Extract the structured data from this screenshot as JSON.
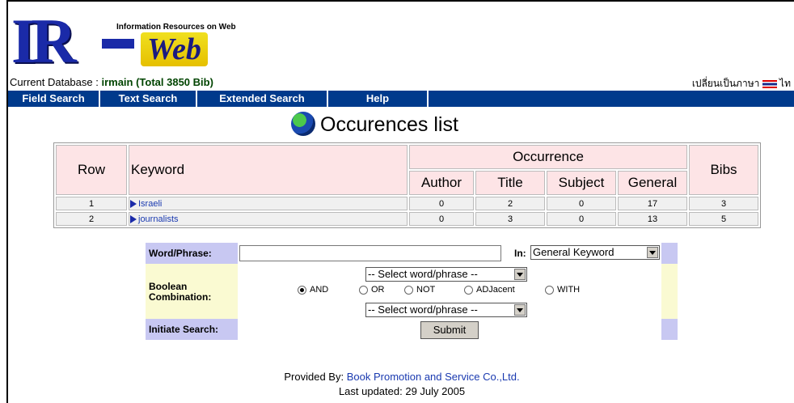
{
  "logo": {
    "main_text": "IR",
    "sub_text": "Web",
    "tagline": "Information Resources on Web"
  },
  "database": {
    "label": "Current Database :",
    "value": "irmain (Total 3850 Bib)"
  },
  "language_link": "เปลี่ยนเป็นภาษา",
  "language_suffix": "ไท",
  "nav": {
    "items": [
      "Field Search",
      "Text Search",
      "Extended Search",
      "Help"
    ]
  },
  "page_title": "Occurences list",
  "table": {
    "headers": {
      "row": "Row",
      "keyword": "Keyword",
      "occurrence": "Occurrence",
      "author": "Author",
      "title": "Title",
      "subject": "Subject",
      "general": "General",
      "bibs": "Bibs"
    },
    "rows": [
      {
        "row": "1",
        "keyword": "Israeli",
        "author": "0",
        "title": "2",
        "subject": "0",
        "general": "17",
        "bibs": "3"
      },
      {
        "row": "2",
        "keyword": "journalists",
        "author": "0",
        "title": "3",
        "subject": "0",
        "general": "13",
        "bibs": "5"
      }
    ]
  },
  "search": {
    "word_label": "Word/Phrase:",
    "word_value": "",
    "in_label": "In:",
    "in_select": "General Keyword",
    "boolean_label_1": "Boolean",
    "boolean_label_2": "Combination:",
    "select_top": "-- Select word/phrase --",
    "select_bottom": "-- Select word/phrase --",
    "options": [
      "AND",
      "OR",
      "NOT",
      "ADJacent",
      "WITH"
    ],
    "selected_option": "AND",
    "initiate_label": "Initiate Search:",
    "submit_label": "Submit"
  },
  "footer": {
    "provided_label": "Provided By:",
    "provider": "Book Promotion and Service Co.,Ltd.",
    "updated": "Last updated: 29 July 2005"
  }
}
